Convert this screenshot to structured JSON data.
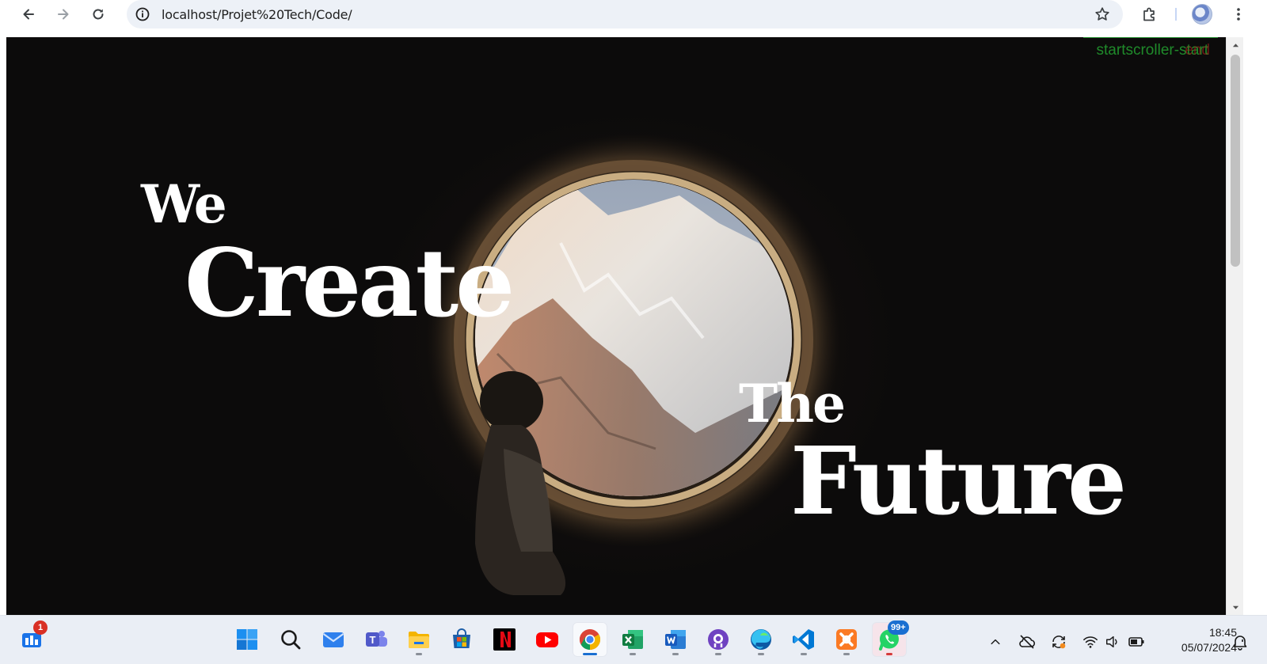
{
  "browser": {
    "url": "localhost/Projet%20Tech/Code/"
  },
  "page": {
    "hero": {
      "word1": "We",
      "word2": "Create",
      "word3": "The",
      "word4": "Future"
    },
    "scroll_label": "startscroller-start",
    "scroll_label_overlay": "end"
  },
  "taskbar": {
    "widgets_badge": "1",
    "whatsapp_badge": "99+",
    "apps": [
      "start",
      "search",
      "mail",
      "teams",
      "file-explorer",
      "microsoft-store",
      "netflix",
      "youtube",
      "chrome",
      "excel",
      "word",
      "github-desktop",
      "edge",
      "vscode",
      "xampp",
      "whatsapp"
    ]
  },
  "tray": {
    "time": "18:45",
    "date": "05/07/2024"
  },
  "colors": {
    "page_background": "#0c0b0b",
    "scroller_label": "#1f8a2a",
    "taskbar": "#eaeef5",
    "active_indicator": "#1a6fd1"
  }
}
